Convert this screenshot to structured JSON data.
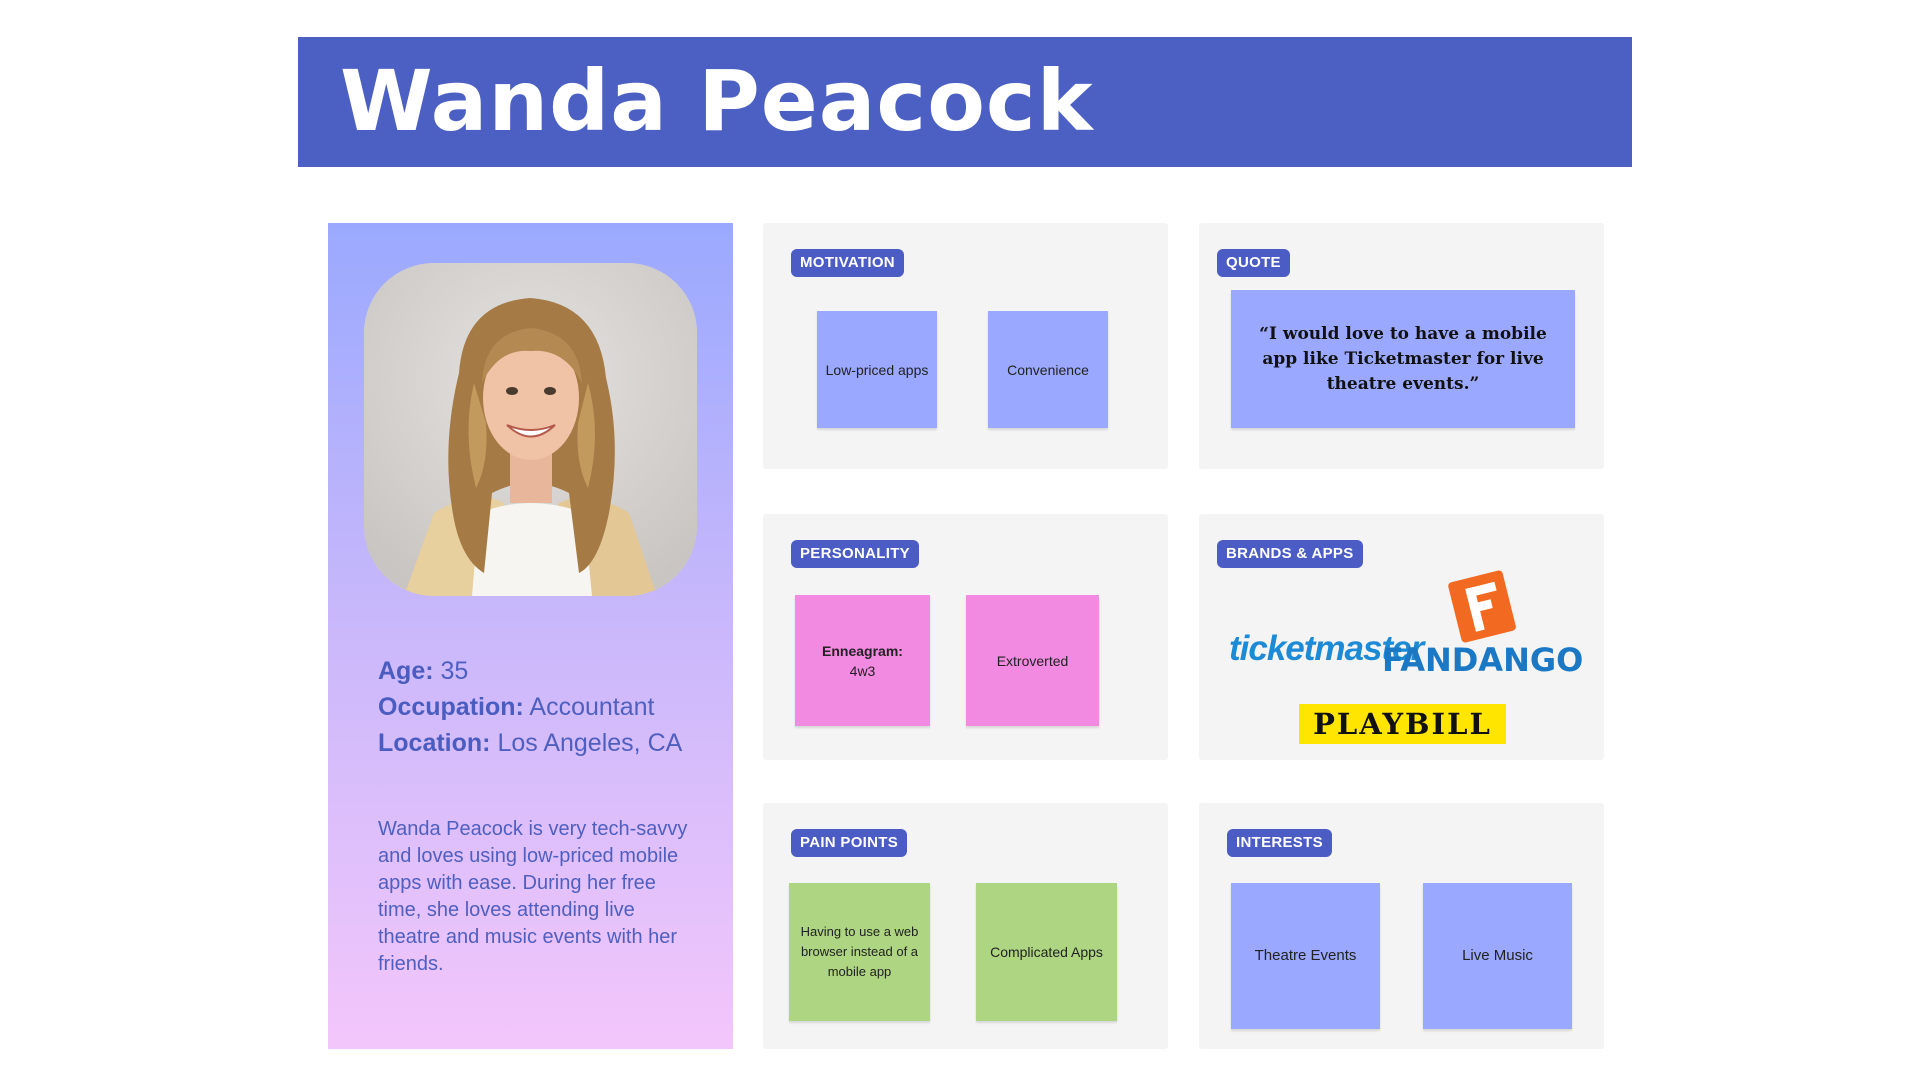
{
  "header": {
    "title": "Wanda Peacock"
  },
  "profile": {
    "photo_alt": "Portrait of a smiling woman with long curly blonde hair",
    "age_label": "Age:",
    "age_value": "35",
    "occupation_label": "Occupation:",
    "occupation_value": "Accountant",
    "location_label": "Location:",
    "location_value": "Los Angeles, CA",
    "bio": "Wanda Peacock is very tech-savvy and loves using low-priced mobile apps with ease. During her free time, she loves attending live theatre and music events with her friends."
  },
  "motivation": {
    "tag": "MOTIVATION",
    "notes": [
      "Low-priced apps",
      "Convenience"
    ]
  },
  "quote": {
    "tag": "QUOTE",
    "text": "“I would love to have a mobile app like Ticketmaster for live theatre events.”"
  },
  "personality": {
    "tag": "PERSONALITY",
    "enneagram_label": "Enneagram:",
    "enneagram_value": "4w3",
    "notes": [
      "Extroverted"
    ]
  },
  "brands": {
    "tag": "BRANDS & APPS",
    "logos": [
      "ticketmaster",
      "FANDANGO",
      "PLAYBILL"
    ]
  },
  "pain_points": {
    "tag": "PAIN POINTS",
    "notes": [
      "Having to use a web browser instead of a mobile app",
      "Complicated Apps"
    ]
  },
  "interests": {
    "tag": "INTERESTS",
    "notes": [
      "Theatre Events",
      "Live Music"
    ]
  },
  "colors": {
    "header": "#4b60c2",
    "tag": "#4b5cc4",
    "note_blue": "#9aa9ff",
    "note_pink": "#f38ae2",
    "note_green": "#aed581",
    "card": "#f4f4f4",
    "playbill_yellow": "#ffe500",
    "fandango_orange": "#f26a21"
  }
}
